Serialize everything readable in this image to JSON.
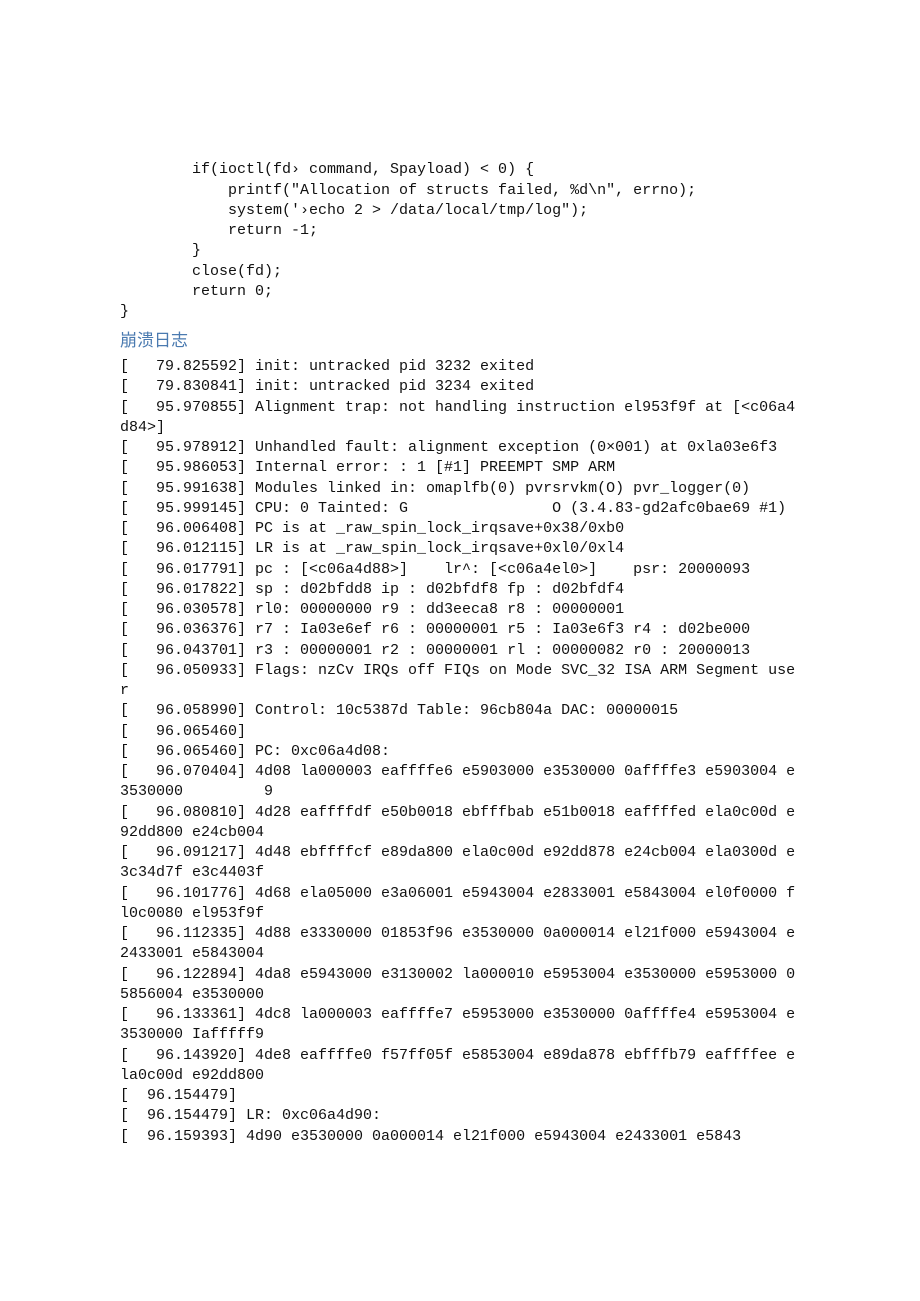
{
  "code": {
    "line1": "        if(ioctl(fd› command, Spayload) < 0) {",
    "line2": "            printf(\"Allocation of structs failed, %d\\n\", errno);",
    "line3": "            system('›echo 2 > /data/local/tmp/log\");",
    "line4": "            return -1;",
    "line5": "        }",
    "line6": "        close(fd);",
    "line7": "        return 0;",
    "line8": "}"
  },
  "heading": "崩溃日志",
  "log": [
    "[   79.825592] init: untracked pid 3232 exited",
    "[   79.830841] init: untracked pid 3234 exited",
    "[   95.970855] Alignment trap: not handling instruction el953f9f at [<c06a4d84>]",
    "[   95.978912] Unhandled fault: alignment exception (0×001) at 0xla03e6f3",
    "[   95.986053] Internal error: : 1 [#1] PREEMPT SMP ARM",
    "[   95.991638] Modules linked in: omaplfb(0) pvrsrvkm(O) pvr_logger(0)",
    "[   95.999145] CPU: 0 Tainted: G                O (3.4.83-gd2afc0bae69 #1)",
    "[   96.006408] PC is at _raw_spin_lock_irqsave+0x38/0xb0",
    "[   96.012115] LR is at _raw_spin_lock_irqsave+0xl0/0xl4",
    "[   96.017791] pc : [<c06a4d88>]    lr^: [<c06a4el0>]    psr: 20000093",
    "[   96.017822] sp : d02bfdd8 ip : d02bfdf8 fp : d02bfdf4",
    "[   96.030578] rl0: 00000000 r9 : dd3eeca8 r8 : 00000001",
    "[   96.036376] r7 : Ia03e6ef r6 : 00000001 r5 : Ia03e6f3 r4 : d02be000",
    "[   96.043701] r3 : 00000001 r2 : 00000001 rl : 00000082 r0 : 20000013",
    "[   96.050933] Flags: nzCv IRQs off FIQs on Mode SVC_32 ISA ARM Segment user",
    "[   96.058990] Control: 10c5387d Table: 96cb804a DAC: 00000015",
    "[   96.065460]",
    "[   96.065460] PC: 0xc06a4d08:",
    "[   96.070404] 4d08 la000003 eaffffe6 e5903000 e3530000 0affffe3 e5903004 e3530000         9",
    "[   96.080810] 4d28 eaffffdf e50b0018 ebfffbab e51b0018 eaffffed ela0c00d e92dd800 e24cb004",
    "[   96.091217] 4d48 ebffffcf e89da800 ela0c00d e92dd878 e24cb004 ela0300d e3c34d7f e3c4403f",
    "[   96.101776] 4d68 ela05000 e3a06001 e5943004 e2833001 e5843004 el0f0000 fl0c0080 el953f9f",
    "[   96.112335] 4d88 e3330000 01853f96 e3530000 0a000014 el21f000 e5943004 e2433001 e5843004",
    "[   96.122894] 4da8 e5943000 e3130002 la000010 e5953004 e3530000 e5953000 05856004 e3530000",
    "[   96.133361] 4dc8 la000003 eaffffe7 e5953000 e3530000 0affffe4 e5953004 e3530000 Iafffff9",
    "[   96.143920] 4de8 eaffffe0 f57ff05f e5853004 e89da878 ebfffb79 eaffffee ela0c00d e92dd800",
    "[  96.154479]",
    "[  96.154479] LR: 0xc06a4d90:",
    "[  96.159393] 4d90 e3530000 0a000014 el21f000 e5943004 e2433001 e5843"
  ]
}
